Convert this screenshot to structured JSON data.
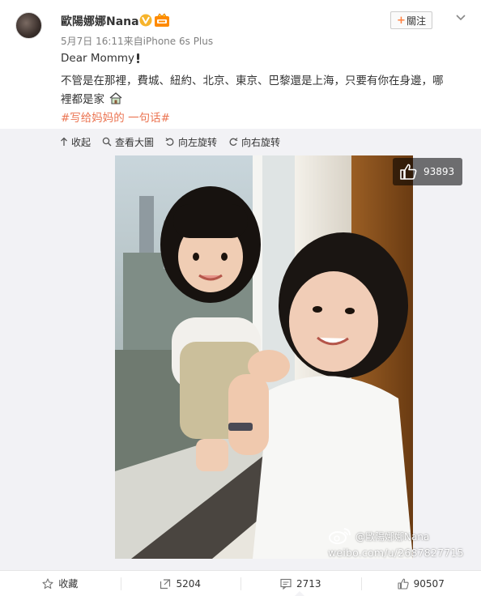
{
  "post": {
    "username": "歐陽娜娜Nana",
    "meta": "5月7日 16:11来自iPhone 6s Plus",
    "text_line1": "Dear Mommy",
    "text_line2": "不管是在那裡，費城、紐約、北京、東京、巴黎還是上海，只要有你在身邊，哪",
    "text_line3": "裡都是家",
    "hashtag": "#写给妈妈的 一句话#",
    "follow_label": "關注",
    "follow_plus": "+"
  },
  "toolbar": {
    "collapse": "收起",
    "view_large": "查看大圖",
    "rotate_left": "向左旋转",
    "rotate_right": "向右旋转"
  },
  "photo": {
    "like_count": "93893",
    "watermark_name": "@歐陽娜娜Nana",
    "watermark_url": "weibo.com/u/2687827715"
  },
  "footer": {
    "favorite": "收藏",
    "repost_count": "5204",
    "comment_count": "2713",
    "like_count": "90507"
  },
  "icons": {
    "verified": "verified-v-icon",
    "badge": "vip-badge-icon",
    "accent": "#eb7350",
    "verified_color": "#f6b42c"
  }
}
